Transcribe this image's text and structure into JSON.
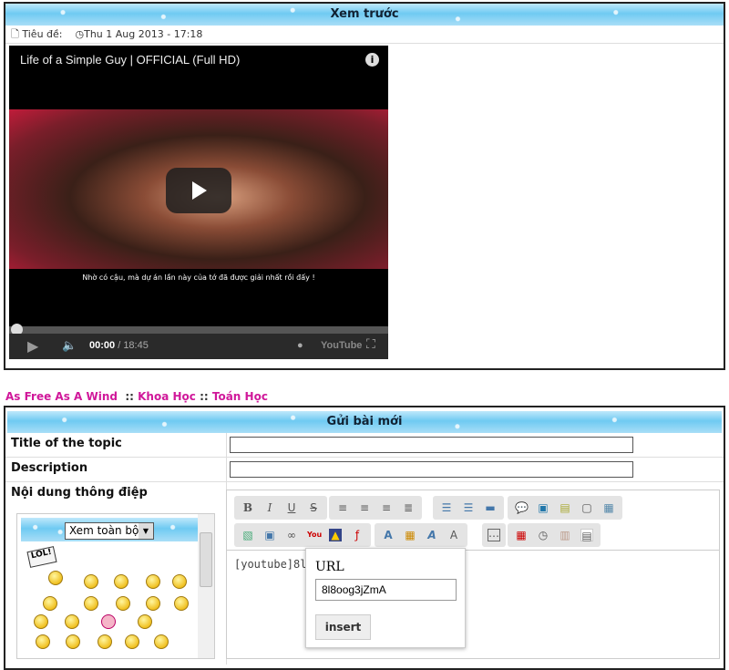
{
  "preview": {
    "header": "Xem trước",
    "title_label": "Tiêu đề:",
    "date": "Thu 1 Aug 2013 - 17:18"
  },
  "video": {
    "title": "Life of a Simple Guy | OFFICIAL (Full HD)",
    "subtitle": "Nhờ có cậu, mà dự án lần này của tớ đã được giải nhất rồi đấy !",
    "current_time": "00:00",
    "duration": "/ 18:45",
    "progress": 0,
    "brand": "YouTube"
  },
  "breadcrumb": [
    {
      "label": "As Free As A Wind"
    },
    {
      "label": "Khoa Học"
    },
    {
      "label": "Toán Học"
    }
  ],
  "breadcrumb_sep": "::",
  "form": {
    "header": "Gửi bài mới",
    "title_label": "Title of the topic",
    "title_value": "",
    "description_label": "Description",
    "description_value": "",
    "content_label": "Nội dung thông điệp",
    "emoticon_select": "Xem toàn bộ",
    "editor_text": "[youtube]8l8oog3jZmA",
    "url_popup": {
      "label": "URL",
      "value": "8l8oog3jZmA",
      "insert_label": "insert"
    }
  },
  "toolbar": {
    "row1": [
      [
        "B",
        "I",
        "U",
        "S"
      ],
      [
        "align-left",
        "align-center",
        "align-right",
        "justify"
      ],
      [
        "bullet-list",
        "numbered-list",
        "hr"
      ],
      [
        "quote",
        "code",
        "spoiler",
        "hide",
        "table"
      ]
    ],
    "row2": [
      [
        "image",
        "image-upload",
        "link",
        "youtube",
        "dailymotion",
        "flash"
      ],
      [
        "font-size",
        "color",
        "font-face",
        "remove-format"
      ],
      [
        "more"
      ],
      [
        "date",
        "time",
        "paste",
        "source"
      ]
    ]
  }
}
